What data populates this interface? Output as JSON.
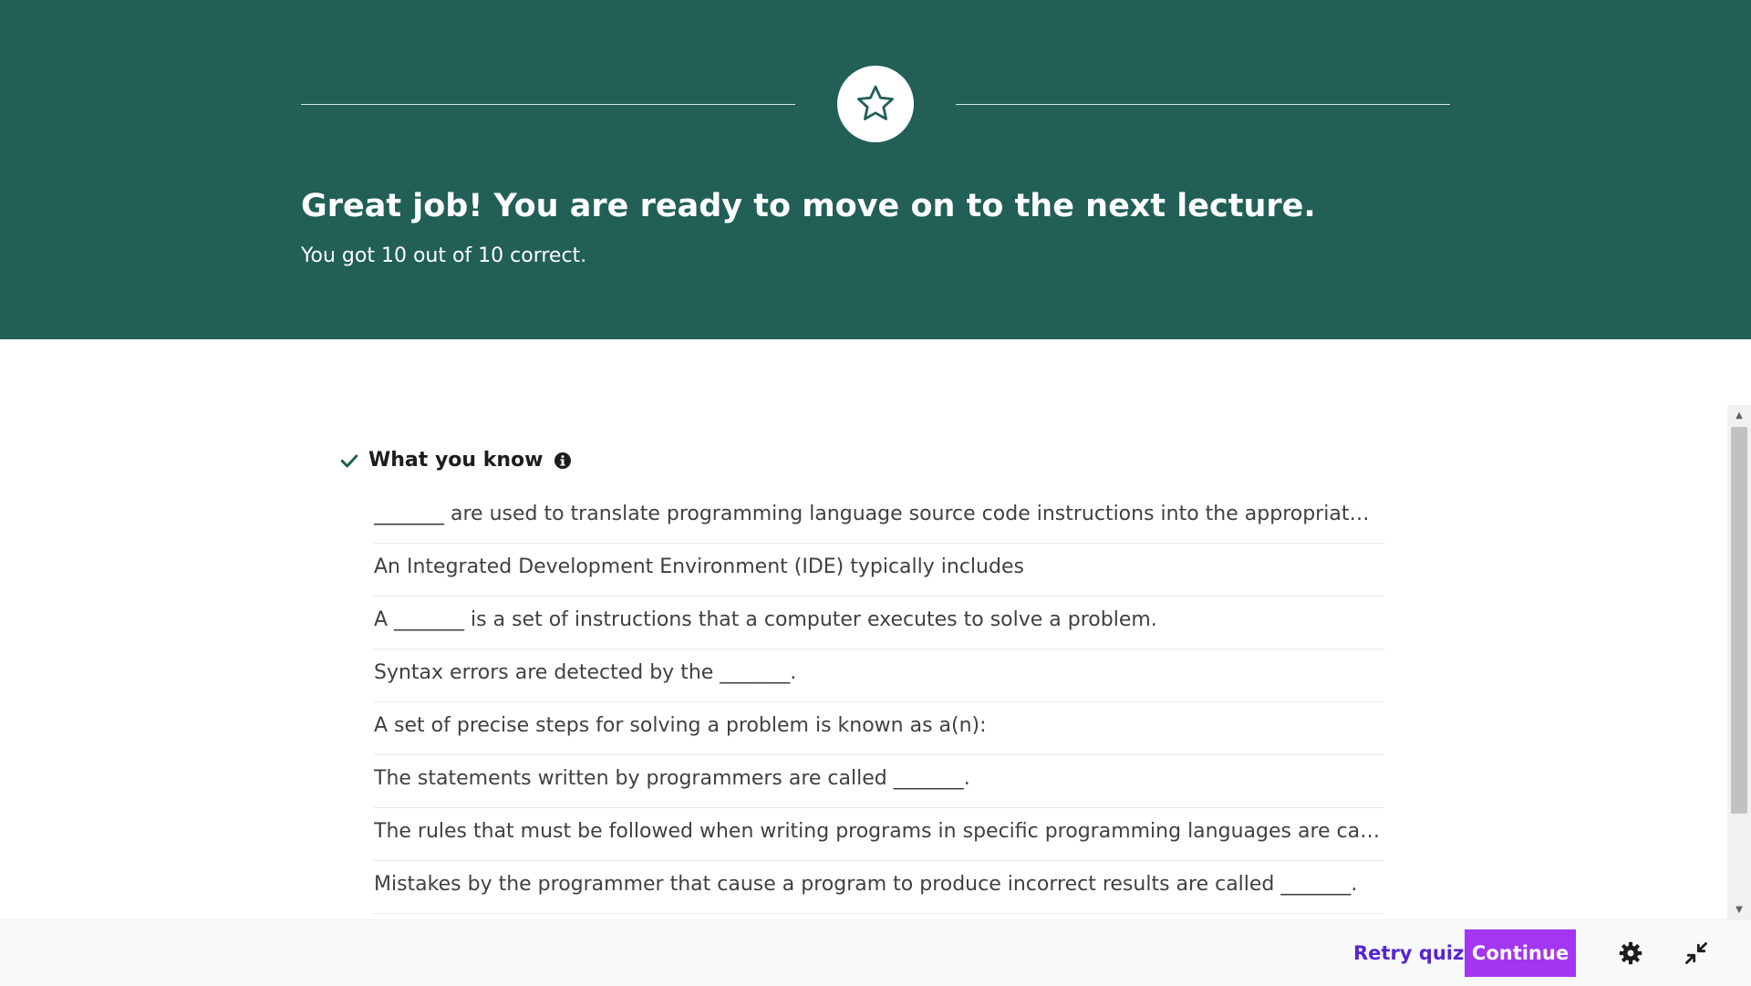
{
  "header": {
    "title": "Great job! You are ready to move on to the next lecture.",
    "subtitle": "You got 10 out of 10 correct.",
    "background_color": "#215f57",
    "icon": "star-icon"
  },
  "section": {
    "title": "What you know",
    "status_icon": "check-icon",
    "info_icon": "info-icon",
    "accent_color": "#1e6055"
  },
  "questions": [
    "_______ are used to translate programming language source code instructions into the appropriate ma...",
    "An Integrated Development Environment (IDE) typically includes",
    "A _______ is a set of instructions that a computer executes to solve a problem.",
    "Syntax errors are detected by the _______.",
    "A set of precise steps for solving a problem is known as a(n):",
    "The statements written by programmers are called _______.",
    "The rules that must be followed when writing programs in specific programming languages are called _...",
    "Mistakes by the programmer that cause a program to produce incorrect results are called _______."
  ],
  "footer": {
    "retry_label": "Retry quiz",
    "continue_label": "Continue",
    "settings_icon": "gear-icon",
    "collapse_icon": "collapse-icon",
    "primary_color": "#a435f0",
    "link_color": "#5624d0"
  }
}
